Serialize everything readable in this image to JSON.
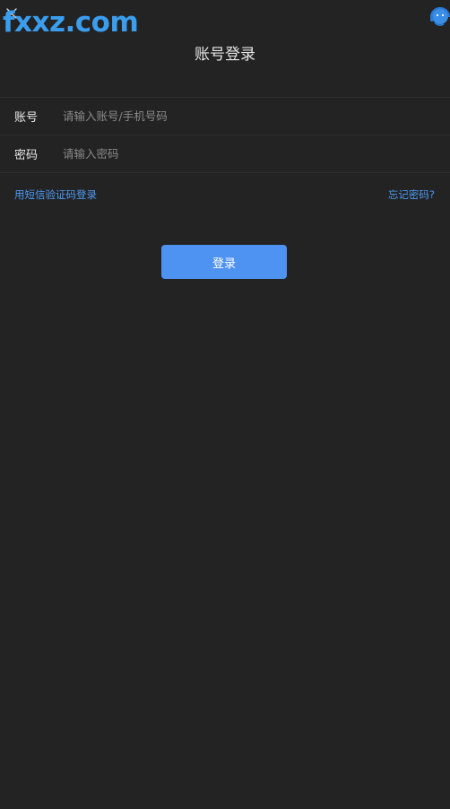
{
  "header": {
    "title": "账号登录",
    "close_icon": "close-icon",
    "support_icon": "customer-service-icon"
  },
  "watermark": {
    "text": "fxxz.com",
    "color": "#3a9dee"
  },
  "form": {
    "account": {
      "label": "账号",
      "value": "",
      "placeholder": "请输入账号/手机号码"
    },
    "password": {
      "label": "密码",
      "value": "",
      "placeholder": "请输入密码"
    }
  },
  "links": {
    "sms_login": "用短信验证码登录",
    "forgot_password": "忘记密码?"
  },
  "actions": {
    "login_label": "登录"
  },
  "colors": {
    "background": "#232323",
    "accent": "#4f93f2",
    "link": "#4c9bf4"
  }
}
